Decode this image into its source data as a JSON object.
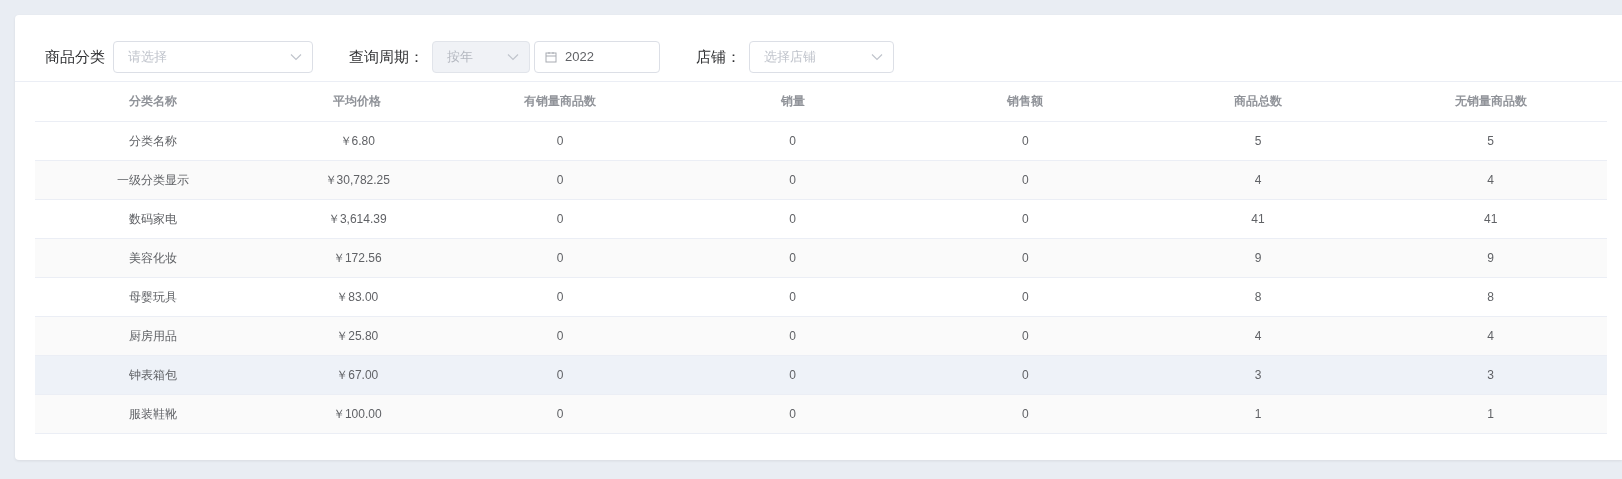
{
  "filters": [
    {
      "label": "商品分类",
      "controls": [
        {
          "kind": "select",
          "placeholder": "请选择",
          "disabled": false
        }
      ]
    },
    {
      "label": "查询周期：",
      "controls": [
        {
          "kind": "select",
          "placeholder": "按年",
          "disabled": true
        },
        {
          "kind": "date",
          "value": "2022"
        }
      ]
    },
    {
      "label": "店铺：",
      "controls": [
        {
          "kind": "select",
          "placeholder": "选择店铺",
          "disabled": false
        }
      ]
    }
  ],
  "table": {
    "columns": [
      "分类名称",
      "平均价格",
      "有销量商品数",
      "销量",
      "销售额",
      "商品总数",
      "无销量商品数"
    ],
    "rows": [
      {
        "cells": [
          "分类名称",
          "￥6.80",
          "0",
          "0",
          "0",
          "5",
          "5"
        ],
        "hovered": false
      },
      {
        "cells": [
          "一级分类显示",
          "￥30,782.25",
          "0",
          "0",
          "0",
          "4",
          "4"
        ],
        "hovered": false
      },
      {
        "cells": [
          "数码家电",
          "￥3,614.39",
          "0",
          "0",
          "0",
          "41",
          "41"
        ],
        "hovered": false
      },
      {
        "cells": [
          "美容化妆",
          "￥172.56",
          "0",
          "0",
          "0",
          "9",
          "9"
        ],
        "hovered": false
      },
      {
        "cells": [
          "母婴玩具",
          "￥83.00",
          "0",
          "0",
          "0",
          "8",
          "8"
        ],
        "hovered": false
      },
      {
        "cells": [
          "厨房用品",
          "￥25.80",
          "0",
          "0",
          "0",
          "4",
          "4"
        ],
        "hovered": false
      },
      {
        "cells": [
          "钟表箱包",
          "￥67.00",
          "0",
          "0",
          "0",
          "3",
          "3"
        ],
        "hovered": true
      },
      {
        "cells": [
          "服装鞋靴",
          "￥100.00",
          "0",
          "0",
          "0",
          "1",
          "1"
        ],
        "hovered": false
      }
    ]
  }
}
